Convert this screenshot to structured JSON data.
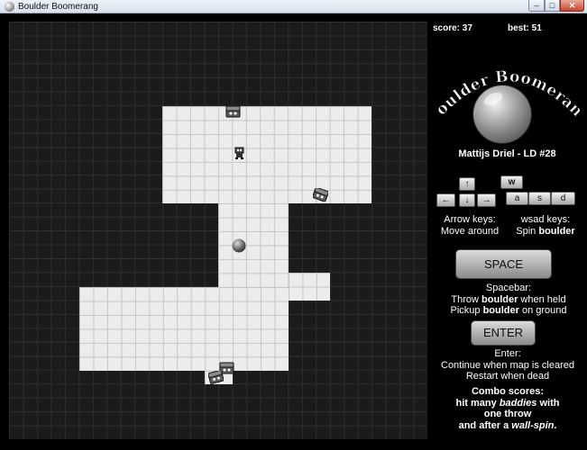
{
  "window": {
    "title": "Boulder Boomerang",
    "buttons": {
      "minimize": "–",
      "maximize": "□",
      "close": "✕"
    }
  },
  "hud": {
    "score_label": "score: 37",
    "best_label": "best: 51"
  },
  "logo": {
    "title": "Boulder Boomerang",
    "icon": "boulder-icon"
  },
  "author": "Mattijs Driel - LD #28",
  "controls": {
    "arrow_keys": {
      "up": "↑",
      "left": "←",
      "down": "↓",
      "right": "→"
    },
    "wsad_keys": {
      "w": "w",
      "a": "a",
      "s": "s",
      "d": "d"
    },
    "arrow_help_title": "Arrow keys:",
    "arrow_help_text": "Move around",
    "wsad_help_title": "wsad keys:",
    "wsad_help_prefix": "Spin ",
    "wsad_help_bold": "boulder"
  },
  "space": {
    "button_label": "SPACE",
    "title": "Spacebar:",
    "line1_prefix": "Throw ",
    "line1_bold": "boulder",
    "line1_suffix": " when held",
    "line2_prefix": "Pickup ",
    "line2_bold": "boulder",
    "line2_suffix": " on ground"
  },
  "enter": {
    "button_label": "ENTER",
    "title": "Enter:",
    "line1": "Continue when map is cleared",
    "line2": "Restart when dead"
  },
  "combo": {
    "title": "Combo scores:",
    "line1_prefix": "hit many ",
    "line1_bold": "baddies",
    "line1_suffix": " with",
    "line2": "one throw",
    "line3_prefix": "and after a ",
    "line3_bold": "wall-spin",
    "line3_suffix": "."
  },
  "entities": {
    "player": "player-icon",
    "enemies": [
      "chest-baddie-icon",
      "chest-baddie-icon",
      "chest-baddie-icon",
      "chest-baddie-icon"
    ],
    "boulder": "boulder-icon"
  }
}
